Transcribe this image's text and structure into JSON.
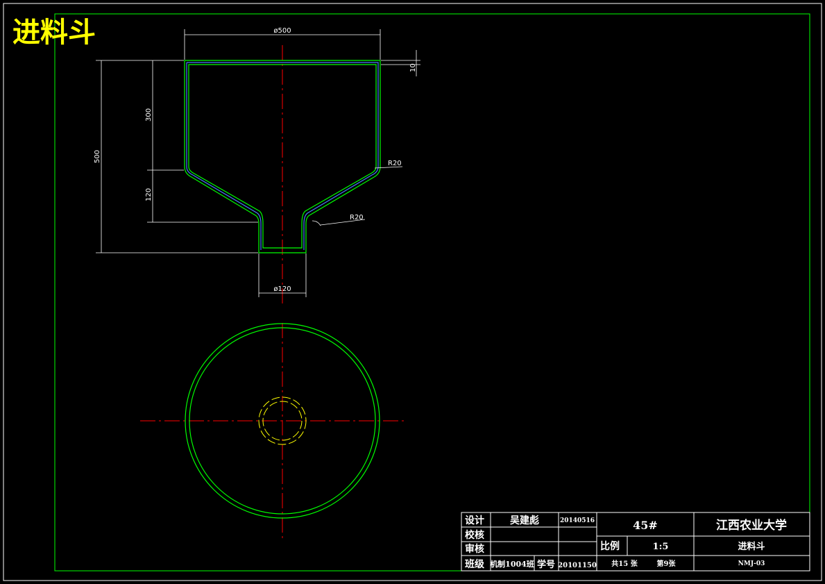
{
  "drawing_title": "进料斗",
  "dimensions": {
    "top_diameter": "ø500",
    "bottom_diameter": "ø120",
    "total_height": "500",
    "upper_height": "300",
    "cone_height": "120",
    "radius_upper": "R20",
    "radius_lower": "R20",
    "wall_thickness": "10"
  },
  "title_block": {
    "design_label": "设计",
    "designer": "吴建彪",
    "design_date": "20140516",
    "check_label": "校核",
    "review_label": "审核",
    "class_label": "班级",
    "class_value": "机制1004班",
    "student_no_label": "学号",
    "student_no": "20101150",
    "material": "45#",
    "university": "江西农业大学",
    "scale_label": "比例",
    "scale_value": "1:5",
    "part_name": "进料斗",
    "sheet_total": "共15 张",
    "sheet_no": "第9张",
    "drawing_code": "NMJ-03"
  },
  "colors": {
    "outline": "#00ff00",
    "center_line": "#ff0000",
    "hidden_line": "#ffff00",
    "inner_line": "#4a7cff",
    "dimension": "#ffffff",
    "title_text": "#ffff00"
  }
}
